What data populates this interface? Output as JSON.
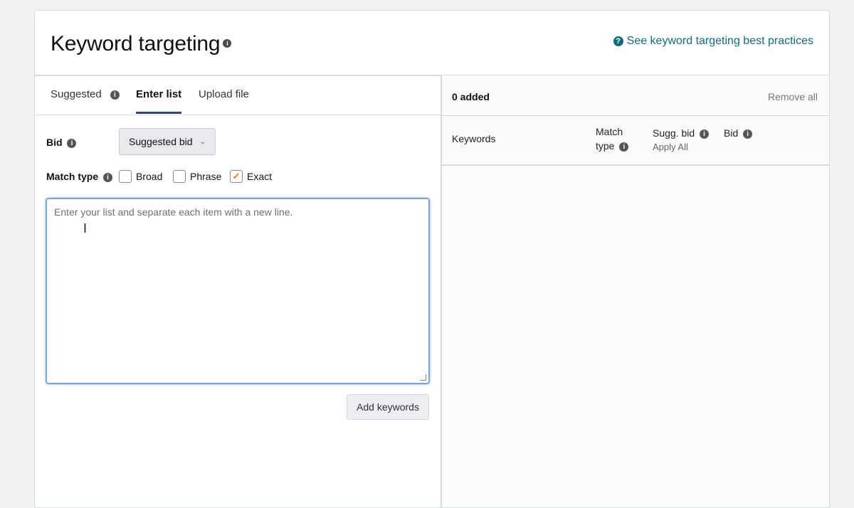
{
  "header": {
    "title": "Keyword targeting",
    "title_info_icon": "info-icon",
    "best_practices_link": "See keyword targeting best practices",
    "best_practices_icon": "help-circle-icon"
  },
  "tabs": [
    {
      "label": "Suggested",
      "has_info": true,
      "active": false
    },
    {
      "label": "Enter list",
      "active": true
    },
    {
      "label": "Upload file",
      "active": false
    }
  ],
  "form": {
    "bid_label": "Bid",
    "bid_select_value": "Suggested bid",
    "match_type_label": "Match type",
    "match_types": [
      {
        "label": "Broad",
        "checked": false
      },
      {
        "label": "Phrase",
        "checked": false
      },
      {
        "label": "Exact",
        "checked": true
      }
    ],
    "textarea_placeholder": "Enter your list and separate each item with a new line.",
    "add_keywords_button": "Add keywords"
  },
  "added_panel": {
    "added_count_text": "0 added",
    "remove_all": "Remove all",
    "columns": {
      "keywords": "Keywords",
      "match_type": "Match type",
      "sugg_bid": "Sugg. bid",
      "apply_all": "Apply All",
      "bid": "Bid"
    }
  },
  "colors": {
    "link": "#0f6b7a",
    "active_tab_underline": "#2c4a67",
    "checkbox_check": "#e47911",
    "textarea_focus": "#7aa7d6"
  }
}
